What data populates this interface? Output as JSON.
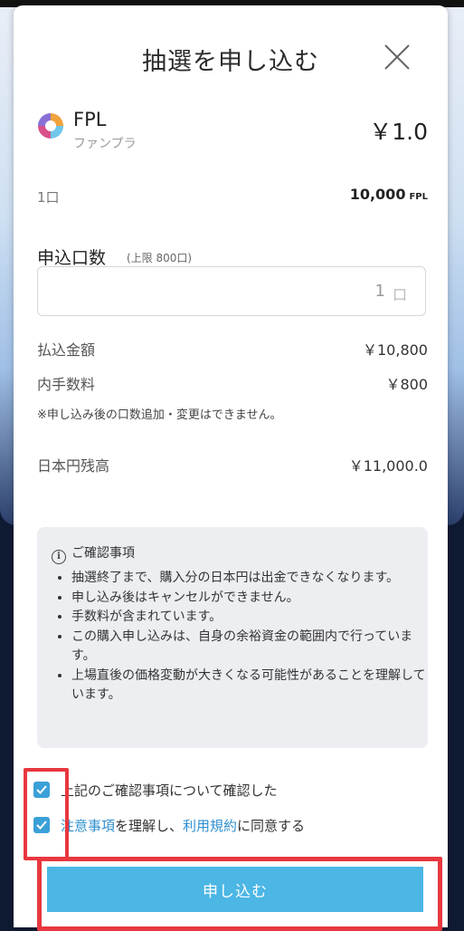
{
  "modal": {
    "title": "抽選を申し込む"
  },
  "token": {
    "name": "FPL",
    "subname": "ファンプラ",
    "price": "￥1.0"
  },
  "unit": {
    "label": "1口",
    "value": "10,000",
    "unit": "FPL"
  },
  "apply": {
    "section_title": "申込口数",
    "limit": "(上限 800口)",
    "quantity": "1",
    "quantity_unit": "口"
  },
  "amounts": {
    "payment_label": "払込金額",
    "payment_value": "￥10,800",
    "fee_label": "内手数料",
    "fee_value": "￥800",
    "note": "※申し込み後の口数追加・変更はできません。",
    "balance_label": "日本円残高",
    "balance_value": "￥11,000.0"
  },
  "confirm": {
    "heading": "ご確認事項",
    "items": [
      "抽選終了まで、購入分の日本円は出金できなくなります。",
      "申し込み後はキャンセルができません。",
      "手数料が含まれています。",
      "この購入申し込みは、自身の余裕資金の範囲内で行っています。",
      "上場直後の価格変動が大きくなる可能性があることを理解しています。"
    ]
  },
  "checks": {
    "check1_text": "上記のご確認事項について確認した",
    "check2_link1": "注意事項",
    "check2_text1": "を理解し、",
    "check2_link2": "利用規約",
    "check2_text2": "に同意する",
    "check1_checked": true,
    "check2_checked": true
  },
  "submit": {
    "label": "申し込む"
  },
  "colors": {
    "accent": "#4cb6e4",
    "checkbox": "#3aa0d8",
    "link": "#2f8fcf",
    "highlight": "#e8373f"
  },
  "icons": {
    "close": "close-icon",
    "info": "info-icon",
    "check": "check-icon",
    "token_logo": "token-logo-icon"
  }
}
